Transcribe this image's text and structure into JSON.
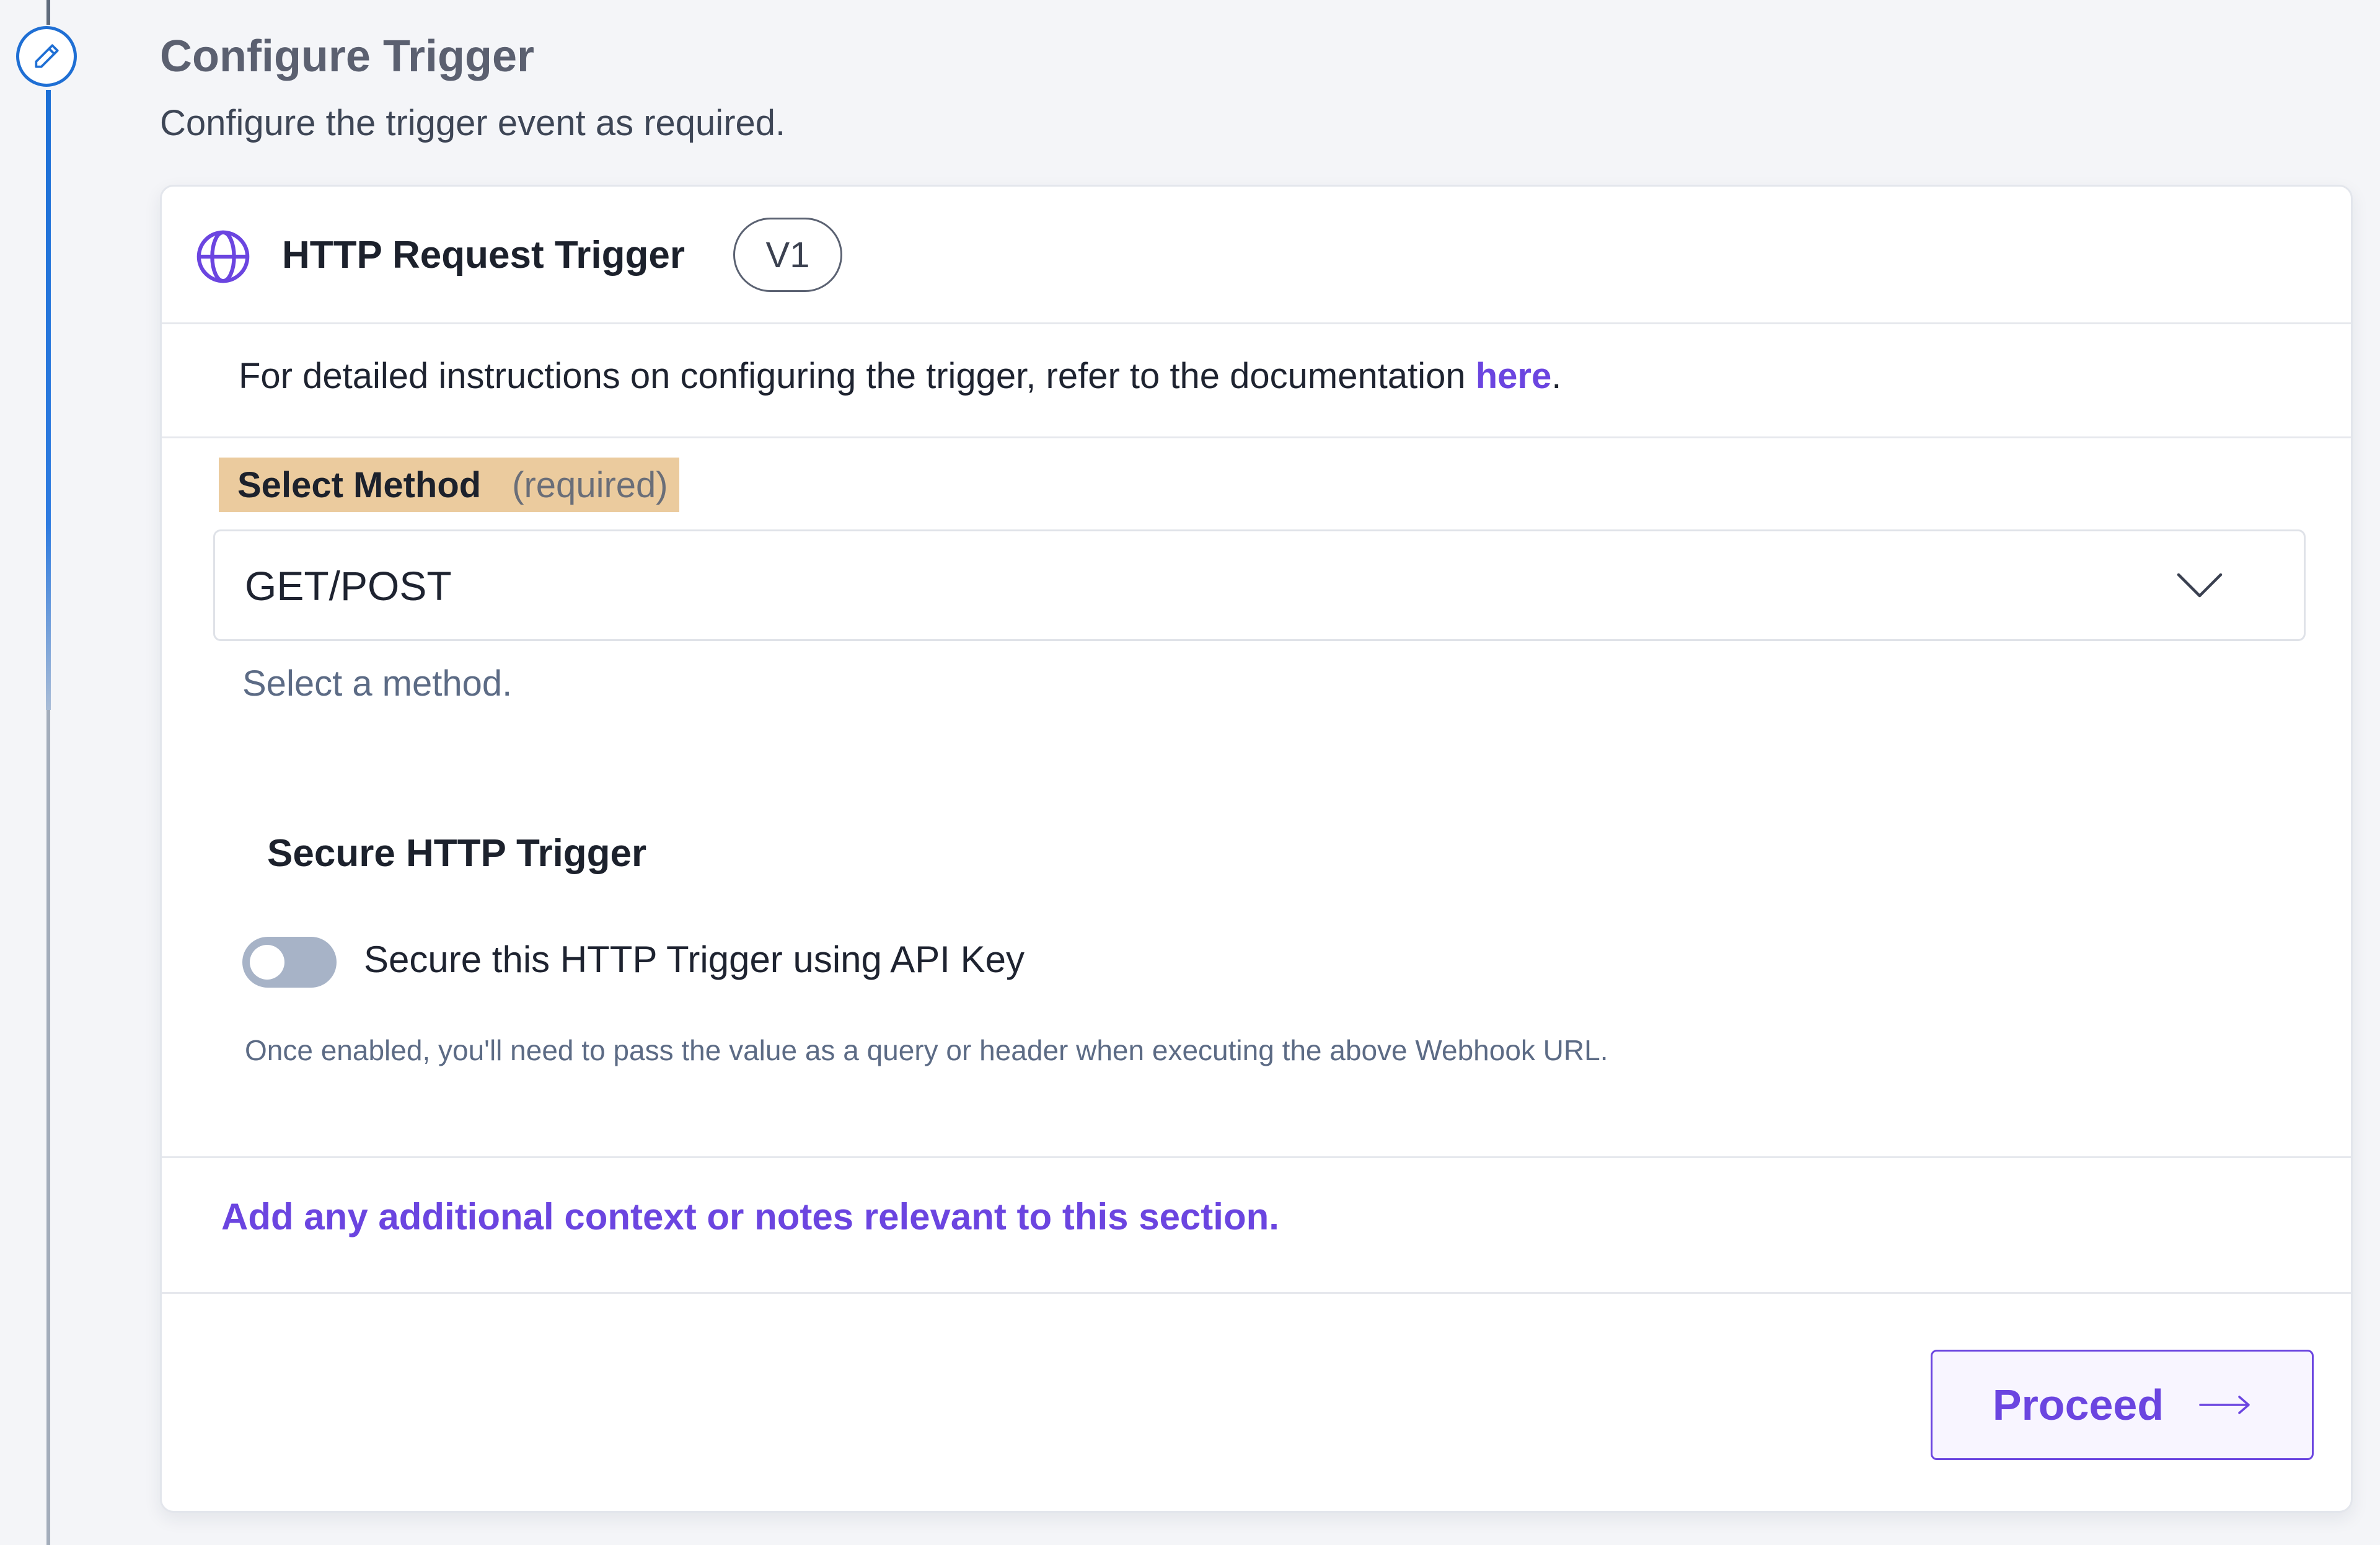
{
  "step": {
    "title": "Configure Trigger",
    "description": "Configure the trigger event as required.",
    "icon": "pencil-icon"
  },
  "trigger": {
    "icon": "globe-icon",
    "name": "HTTP Request Trigger",
    "version": "V1"
  },
  "docs": {
    "text": "For detailed instructions on configuring the trigger, refer to the documentation ",
    "link_label": "here",
    "suffix": "."
  },
  "method": {
    "label": "Select Method",
    "required": "(required)",
    "value": "GET/POST",
    "help": "Select a method."
  },
  "secure": {
    "title": "Secure HTTP Trigger",
    "toggle_label": "Secure this HTTP Trigger using API Key",
    "toggle_on": false,
    "help": "Once enabled, you'll need to pass the value as a query or header when executing the above Webhook URL."
  },
  "notes": {
    "link_label": "Add any additional context or notes relevant to this section."
  },
  "actions": {
    "proceed_label": "Proceed"
  },
  "colors": {
    "accent": "#6b45e0",
    "rail": "#1f6fd4",
    "highlight": "#ebcb9e"
  }
}
